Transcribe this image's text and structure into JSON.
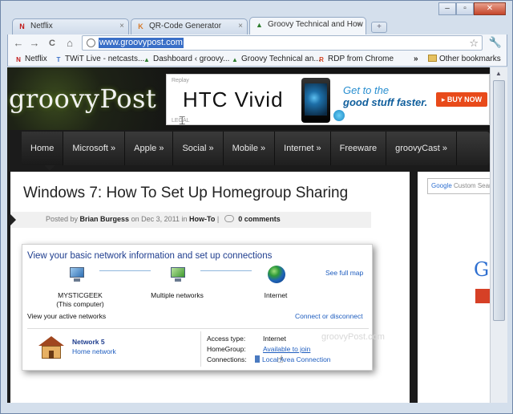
{
  "window": {
    "controls": {
      "minimize": "–",
      "maximize": "▫",
      "close": "✕"
    }
  },
  "tabs": [
    {
      "title": "Netflix",
      "favicon": "N",
      "favicon_color": "#c11a1a",
      "active": false
    },
    {
      "title": "QR-Code Generator",
      "favicon": "K",
      "favicon_color": "#d77a2a",
      "active": false
    },
    {
      "title": "Groovy Technical and How",
      "favicon": "▲",
      "favicon_color": "#2e7d2e",
      "active": true
    }
  ],
  "toolbar": {
    "back": "←",
    "forward": "→",
    "reload": "C",
    "home": "⌂",
    "url": "www.groovypost.com",
    "star": "☆",
    "wrench": "🔧"
  },
  "bookmarks": {
    "items": [
      {
        "label": "Netflix",
        "favicon": "N",
        "color": "#c11a1a"
      },
      {
        "label": "TWiT Live - netcasts...",
        "favicon": "T",
        "color": "#3a6fc7"
      },
      {
        "label": "Dashboard ‹ groovy...",
        "favicon": "▲",
        "color": "#2e7d2e"
      },
      {
        "label": "Groovy Technical an...",
        "favicon": "▲",
        "color": "#2e7d2e"
      },
      {
        "label": "RDP from Chrome",
        "favicon": "R",
        "color": "#d04020"
      }
    ],
    "more": "»",
    "other": "Other bookmarks"
  },
  "site": {
    "logo": "groovyPost",
    "ad": {
      "replay": "Replay",
      "legal": "LEGAL",
      "brand": "HTC Vivid",
      "tagline_1": "Get to the",
      "tagline_2": "good stuff faster.",
      "cta": "▸ BUY NOW"
    },
    "nav": [
      {
        "label": "Home",
        "active": true
      },
      {
        "label": "Microsoft »",
        "active": false
      },
      {
        "label": "Apple »",
        "active": false
      },
      {
        "label": "Social »",
        "active": false
      },
      {
        "label": "Mobile »",
        "active": false
      },
      {
        "label": "Internet »",
        "active": false
      },
      {
        "label": "Freeware",
        "active": false
      },
      {
        "label": "groovyCast »",
        "active": false
      }
    ],
    "search_placeholder": "Custom Search",
    "search_brand": "Google",
    "sidebar_letter": "G"
  },
  "post": {
    "title": "Windows 7: How To Set Up Homegroup Sharing",
    "meta_posted_by": "Posted by",
    "author": "Brian Burgess",
    "meta_on": "on Dec 3, 2011 in",
    "category": "How-To",
    "meta_sep": "|",
    "comments": "0 comments"
  },
  "panel": {
    "title": "View your basic network information and set up connections",
    "see_full_map": "See full map",
    "node_1": "MYSTICGEEK",
    "node_1_sub": "(This computer)",
    "node_2": "Multiple networks",
    "node_3": "Internet",
    "active_networks": "View your active networks",
    "connect_disconnect": "Connect or disconnect",
    "network_name": "Network  5",
    "network_type": "Home network",
    "access_type_label": "Access type:",
    "access_type_value": "Internet",
    "homegroup_label": "HomeGroup:",
    "homegroup_value": "Available to join",
    "connections_label": "Connections:",
    "connections_value": "Local Area Connection"
  },
  "watermark": "groovyPost.com"
}
